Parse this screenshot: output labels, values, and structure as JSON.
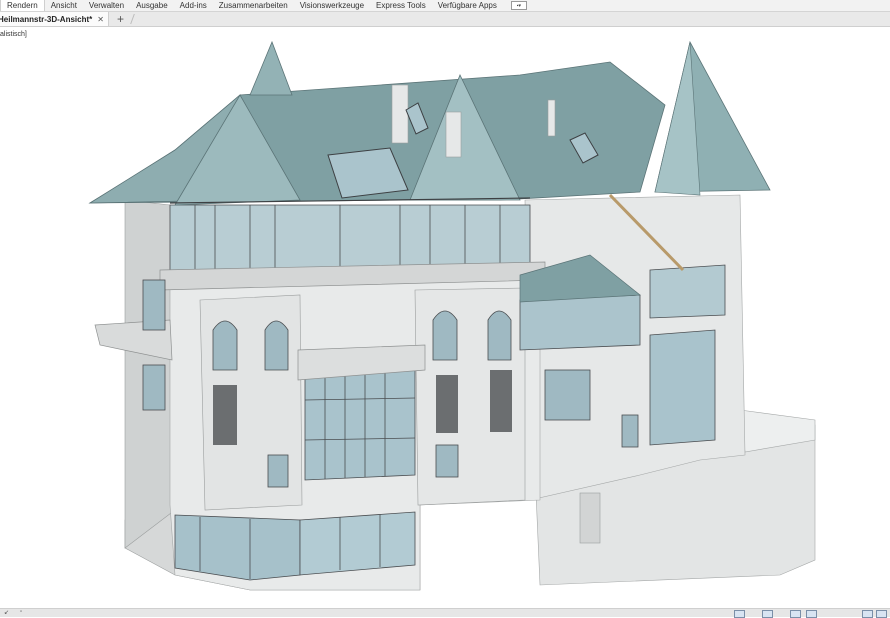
{
  "ribbon": {
    "tabs": [
      "Rendern",
      "Ansicht",
      "Verwalten",
      "Ausgabe",
      "Add-ins",
      "Zusammenarbeiten",
      "Visionswerkzeuge",
      "Express Tools",
      "Verfügbare Apps"
    ],
    "active_tab": "Rendern",
    "overflow_icon": "dropdown-menu-icon"
  },
  "document": {
    "tab_title": "Heilmannstr-3D-Ansicht*",
    "close_glyph": "✕",
    "add_glyph": "+"
  },
  "viewport": {
    "style_label": "alistisch]"
  },
  "colors": {
    "roof": "#7fa0a3",
    "wall": "#e4e6e6",
    "glass": "#a9c3cc",
    "frame": "#4a4d50",
    "ribbon_bg": "#f2f2f2"
  }
}
